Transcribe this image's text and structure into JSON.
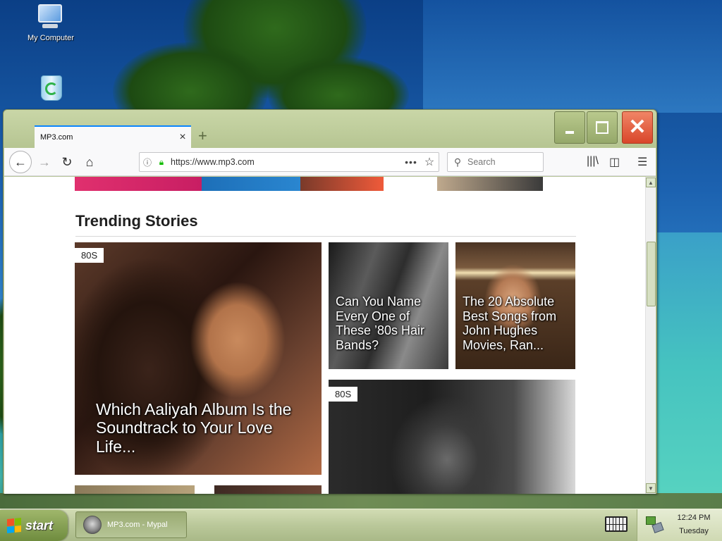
{
  "desktop": {
    "icons": [
      {
        "label": "My Computer"
      },
      {
        "label": ""
      }
    ]
  },
  "browser": {
    "tab": {
      "title": "MP3.com"
    },
    "urlbar": {
      "url": "https://www.mp3.com"
    },
    "search": {
      "placeholder": "Search"
    },
    "colors": {
      "accent": "#0a84ff",
      "lock": "#12bc00",
      "close": "#d9462a"
    }
  },
  "page": {
    "section_title": "Trending Stories",
    "stories": [
      {
        "badge": "80S",
        "caption": "Which Aaliyah Album Is the Soundtrack to Your Love Life..."
      },
      {
        "badge": "",
        "caption": "Can You Name Every One of These ’80s Hair Bands?"
      },
      {
        "badge": "",
        "caption": "The 20 Absolute Best Songs from John Hughes Movies, Ran..."
      },
      {
        "badge": "80S",
        "caption": ""
      }
    ]
  },
  "taskbar": {
    "start_label": "start",
    "task_label": "MP3.com - Mypal",
    "clock_time": "12:24 PM",
    "clock_day": "Tuesday"
  }
}
